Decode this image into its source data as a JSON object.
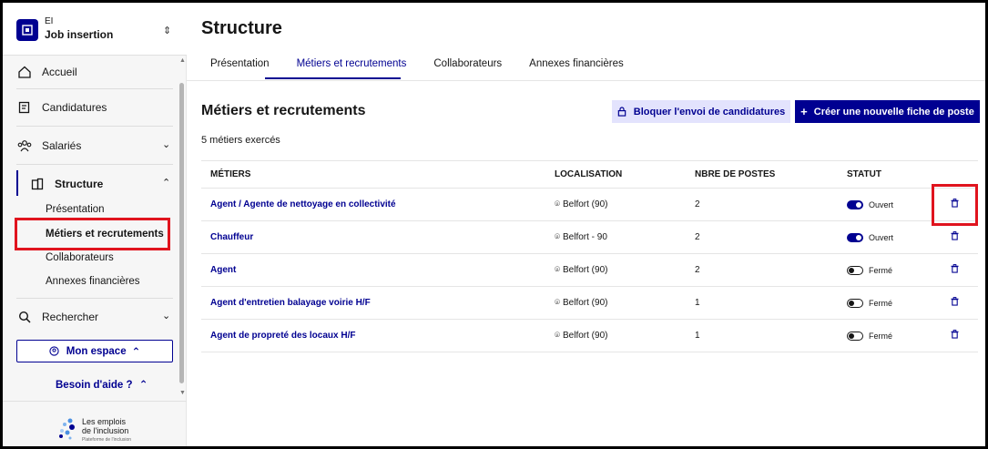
{
  "org": {
    "type": "EI",
    "name": "Job insertion",
    "toggle_icon": "chevron-up-down-icon"
  },
  "nav": {
    "accueil": "Accueil",
    "candidatures": "Candidatures",
    "salaries": "Salariés",
    "structure": "Structure",
    "structure_sub": [
      "Présentation",
      "Métiers et recrutements",
      "Collaborateurs",
      "Annexes financières"
    ],
    "rechercher": "Rechercher",
    "mon_espace": "Mon espace",
    "besoin_aide": "Besoin d'aide ?"
  },
  "footer": {
    "line1": "Les emplois",
    "line2": "de l'inclusion",
    "line3": "Plateforme de l'inclusion"
  },
  "page": {
    "title": "Structure",
    "tabs": [
      "Présentation",
      "Métiers et recrutements",
      "Collaborateurs",
      "Annexes financières"
    ],
    "active_tab": "Métiers et recrutements",
    "section_title": "Métiers et recrutements",
    "count": "5 métiers exercés",
    "block_button": "Bloquer l'envoi de candidatures",
    "create_button": "Créer une nouvelle fiche de poste"
  },
  "table": {
    "headers": [
      "MÉTIERS",
      "LOCALISATION",
      "NBRE DE POSTES",
      "STATUT"
    ],
    "rows": [
      {
        "metier": "Agent / Agente de nettoyage en collectivité",
        "localisation": "Belfort (90)",
        "postes": "2",
        "statut": "Ouvert",
        "open": true
      },
      {
        "metier": "Chauffeur",
        "localisation": "Belfort - 90",
        "postes": "2",
        "statut": "Ouvert",
        "open": true
      },
      {
        "metier": "Agent",
        "localisation": "Belfort (90)",
        "postes": "2",
        "statut": "Fermé",
        "open": false
      },
      {
        "metier": "Agent d'entretien balayage voirie H/F",
        "localisation": "Belfort (90)",
        "postes": "1",
        "statut": "Fermé",
        "open": false
      },
      {
        "metier": "Agent de propreté des locaux H/F",
        "localisation": "Belfort (90)",
        "postes": "1",
        "statut": "Fermé",
        "open": false
      }
    ]
  },
  "colors": {
    "primary": "#000091",
    "highlight": "#e0141e",
    "secondary_bg": "#e3e3fd"
  }
}
